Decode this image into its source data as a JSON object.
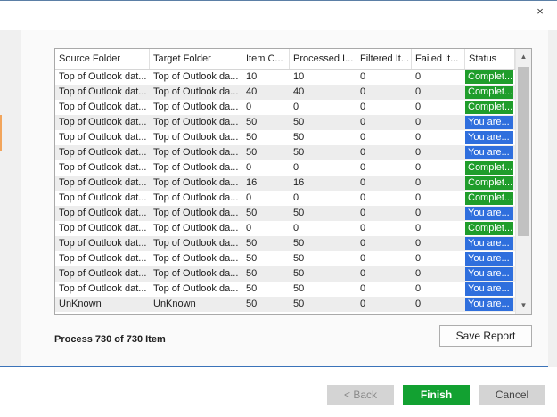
{
  "window": {
    "close_glyph": "×"
  },
  "grid": {
    "columns": [
      "Source Folder",
      "Target Folder",
      "Item C...",
      "Processed I...",
      "Filtered It...",
      "Failed It...",
      "Status"
    ],
    "rows": [
      {
        "source": "Top of Outlook dat...",
        "target": "Top of Outlook da...",
        "item_count": "10",
        "processed": "10",
        "filtered": "0",
        "failed": "0",
        "status": "Complet...",
        "status_kind": "done"
      },
      {
        "source": "Top of Outlook dat...",
        "target": "Top of Outlook da...",
        "item_count": "40",
        "processed": "40",
        "filtered": "0",
        "failed": "0",
        "status": "Complet...",
        "status_kind": "done"
      },
      {
        "source": "Top of Outlook dat...",
        "target": "Top of Outlook da...",
        "item_count": "0",
        "processed": "0",
        "filtered": "0",
        "failed": "0",
        "status": "Complet...",
        "status_kind": "done"
      },
      {
        "source": "Top of Outlook dat...",
        "target": "Top of Outlook da...",
        "item_count": "50",
        "processed": "50",
        "filtered": "0",
        "failed": "0",
        "status": "You are...",
        "status_kind": "blue"
      },
      {
        "source": "Top of Outlook dat...",
        "target": "Top of Outlook da...",
        "item_count": "50",
        "processed": "50",
        "filtered": "0",
        "failed": "0",
        "status": "You are...",
        "status_kind": "blue"
      },
      {
        "source": "Top of Outlook dat...",
        "target": "Top of Outlook da...",
        "item_count": "50",
        "processed": "50",
        "filtered": "0",
        "failed": "0",
        "status": "You are...",
        "status_kind": "blue"
      },
      {
        "source": "Top of Outlook dat...",
        "target": "Top of Outlook da...",
        "item_count": "0",
        "processed": "0",
        "filtered": "0",
        "failed": "0",
        "status": "Complet...",
        "status_kind": "done"
      },
      {
        "source": "Top of Outlook dat...",
        "target": "Top of Outlook da...",
        "item_count": "16",
        "processed": "16",
        "filtered": "0",
        "failed": "0",
        "status": "Complet...",
        "status_kind": "done"
      },
      {
        "source": "Top of Outlook dat...",
        "target": "Top of Outlook da...",
        "item_count": "0",
        "processed": "0",
        "filtered": "0",
        "failed": "0",
        "status": "Complet...",
        "status_kind": "done"
      },
      {
        "source": "Top of Outlook dat...",
        "target": "Top of Outlook da...",
        "item_count": "50",
        "processed": "50",
        "filtered": "0",
        "failed": "0",
        "status": "You are...",
        "status_kind": "blue"
      },
      {
        "source": "Top of Outlook dat...",
        "target": "Top of Outlook da...",
        "item_count": "0",
        "processed": "0",
        "filtered": "0",
        "failed": "0",
        "status": "Complet...",
        "status_kind": "done"
      },
      {
        "source": "Top of Outlook dat...",
        "target": "Top of Outlook da...",
        "item_count": "50",
        "processed": "50",
        "filtered": "0",
        "failed": "0",
        "status": "You are...",
        "status_kind": "blue"
      },
      {
        "source": "Top of Outlook dat...",
        "target": "Top of Outlook da...",
        "item_count": "50",
        "processed": "50",
        "filtered": "0",
        "failed": "0",
        "status": "You are...",
        "status_kind": "blue"
      },
      {
        "source": "Top of Outlook dat...",
        "target": "Top of Outlook da...",
        "item_count": "50",
        "processed": "50",
        "filtered": "0",
        "failed": "0",
        "status": "You are...",
        "status_kind": "blue"
      },
      {
        "source": "Top of Outlook dat...",
        "target": "Top of Outlook da...",
        "item_count": "50",
        "processed": "50",
        "filtered": "0",
        "failed": "0",
        "status": "You are...",
        "status_kind": "blue"
      },
      {
        "source": "UnKnown",
        "target": "UnKnown",
        "item_count": "50",
        "processed": "50",
        "filtered": "0",
        "failed": "0",
        "status": "You are...",
        "status_kind": "blue"
      }
    ],
    "status_colors": {
      "done": "#1f9d2b",
      "blue": "#2f6fdd"
    }
  },
  "progress_text": "Process 730 of 730 Item",
  "buttons": {
    "save_report": "Save Report",
    "back": "< Back",
    "finish": "Finish",
    "cancel": "Cancel"
  },
  "icons": [
    "close-icon",
    "scroll-up-arrow-icon",
    "scroll-down-arrow-icon"
  ]
}
